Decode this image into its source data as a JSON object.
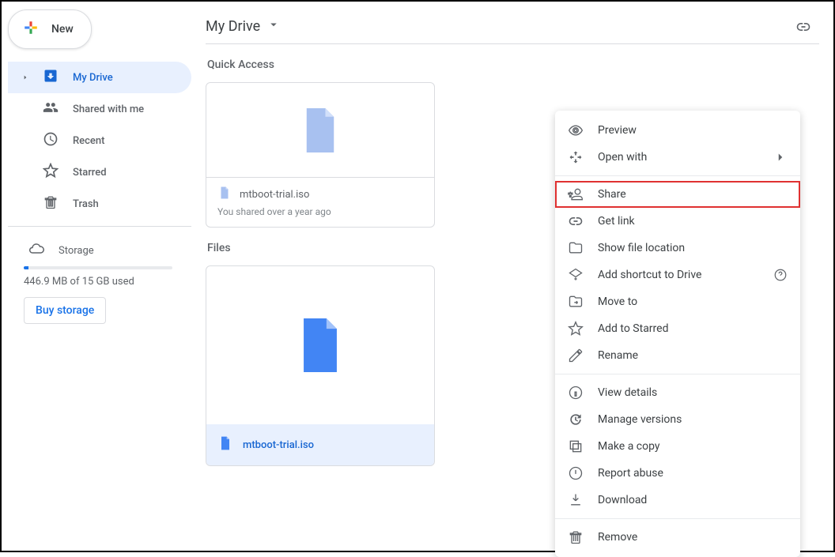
{
  "header": {
    "new_label": "New",
    "breadcrumb": "My Drive"
  },
  "sidebar": {
    "items": [
      {
        "label": "My Drive"
      },
      {
        "label": "Shared with me"
      },
      {
        "label": "Recent"
      },
      {
        "label": "Starred"
      },
      {
        "label": "Trash"
      }
    ],
    "storage_label": "Storage",
    "storage_used": "446.9 MB of 15 GB used",
    "buy_storage": "Buy storage"
  },
  "main": {
    "quick_access_title": "Quick Access",
    "files_title": "Files",
    "qa_file_name": "mtboot-trial.iso",
    "qa_subtext": "You shared over a year ago",
    "file_name": "mtboot-trial.iso"
  },
  "context_menu": {
    "preview": "Preview",
    "open_with": "Open with",
    "share": "Share",
    "get_link": "Get link",
    "show_location": "Show file location",
    "add_shortcut": "Add shortcut to Drive",
    "move_to": "Move to",
    "add_starred": "Add to Starred",
    "rename": "Rename",
    "view_details": "View details",
    "manage_versions": "Manage versions",
    "make_copy": "Make a copy",
    "report_abuse": "Report abuse",
    "download": "Download",
    "remove": "Remove"
  }
}
